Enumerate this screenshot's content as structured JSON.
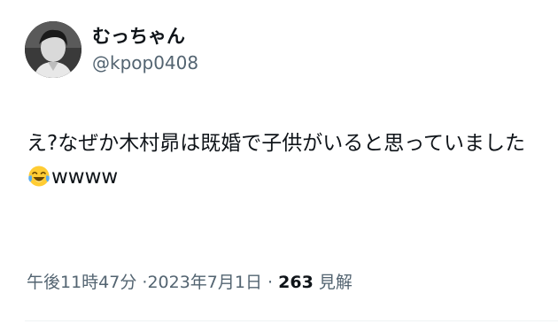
{
  "user": {
    "display_name": "むっちゃん",
    "handle": "@kpop0408"
  },
  "tweet": {
    "text_before_emoji": "え?なぜか木村昴は既婚で子供がいると思っていました",
    "emoji_icon": "face-with-tears-of-joy-icon",
    "text_after_emoji": "wwww"
  },
  "meta": {
    "time": "午後11時47分",
    "separator1": "·",
    "date": "2023年7月1日",
    "separator2": "·",
    "views_count": "263",
    "views_label": "見解"
  },
  "colors": {
    "text_primary": "#0f1419",
    "text_secondary": "#536471",
    "divider": "#eff3f4",
    "emoji_face": "#FFCC33",
    "emoji_tears": "#5DADEC"
  }
}
